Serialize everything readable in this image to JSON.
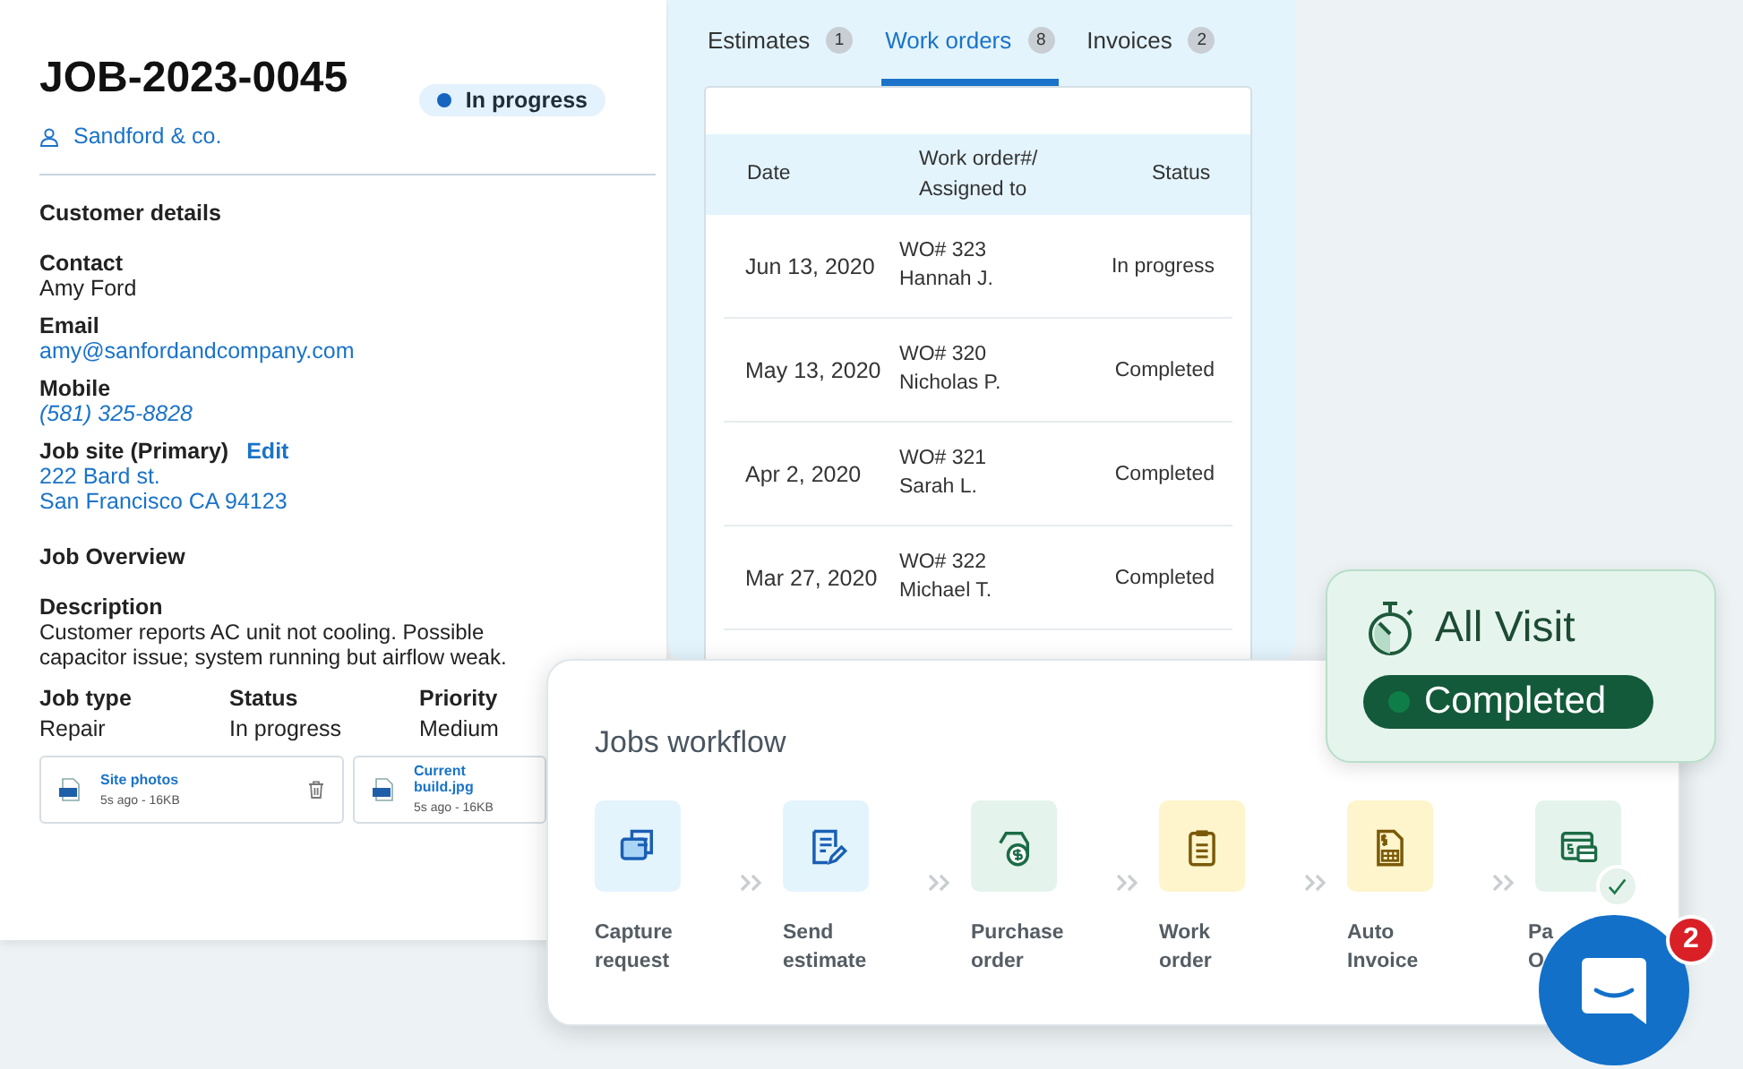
{
  "job": {
    "id": "JOB-2023-0045",
    "customer": "Sandford & co.",
    "status": "In progress",
    "customer_details": {
      "heading": "Customer details",
      "fields": [
        {
          "label": "Contact",
          "value": "Amy Ford",
          "kind": "text"
        },
        {
          "label": "Email",
          "value": "amy@sanfordandcompany.com",
          "kind": "link"
        },
        {
          "label": "Mobile",
          "value": "(581) 325-8828",
          "kind": "phone"
        }
      ],
      "job_site": {
        "label": "Job site (Primary)",
        "action": "Edit",
        "lines": [
          "222 Bard st.",
          "San Francisco CA 94123"
        ]
      }
    },
    "overview": {
      "heading": "Job Overview",
      "description_label": "Description",
      "description": "Customer reports AC unit not cooling. Possible capacitor issue; system running but airflow weak.",
      "facts": [
        {
          "label": "Job type",
          "value": "Repair"
        },
        {
          "label": "Status",
          "value": "In progress"
        },
        {
          "label": "Priority",
          "value": "Medium"
        }
      ],
      "attachments": [
        {
          "name": "Site photos",
          "meta": "5s ago - 16KB",
          "kind": "removable"
        },
        {
          "name": "Current build.jpg",
          "meta": "5s ago - 16KB",
          "kind": "file"
        }
      ]
    }
  },
  "orders": {
    "tabs": [
      {
        "label": "Estimates",
        "count": "1",
        "selected": false
      },
      {
        "label": "Work orders",
        "count": "8",
        "selected": true
      },
      {
        "label": "Invoices",
        "count": "2",
        "selected": false
      }
    ],
    "columns": [
      "Date",
      "Work order#/ Assigned to",
      "Status"
    ],
    "rows": [
      {
        "date": "Jun 13, 2020",
        "work_order": "WO# 323",
        "assignee": "Hannah J.",
        "status": "In progress"
      },
      {
        "date": "May 13, 2020",
        "work_order": "WO# 320",
        "assignee": "Nicholas P.",
        "status": "Completed"
      },
      {
        "date": "Apr 2, 2020",
        "work_order": "WO# 321",
        "assignee": "Sarah L.",
        "status": "Completed"
      },
      {
        "date": "Mar 27, 2020",
        "work_order": "WO# 322",
        "assignee": "Michael T.",
        "status": "Completed"
      }
    ]
  },
  "workflow": {
    "title": "Jobs workflow",
    "steps": [
      {
        "label": [
          "Capture",
          "request"
        ],
        "color": "#e3f4fd",
        "done": false
      },
      {
        "label": [
          "Send",
          "estimate"
        ],
        "color": "#e3f4fd",
        "done": false
      },
      {
        "label": [
          "Purchase",
          "order"
        ],
        "color": "#e4f3ec",
        "done": false
      },
      {
        "label": [
          "Work",
          "order"
        ],
        "color": "#fff5cc",
        "done": false
      },
      {
        "label": [
          "Auto",
          "Invoice"
        ],
        "color": "#fff5cc",
        "done": false
      },
      {
        "label": [
          "Pa",
          "O"
        ],
        "color": "#e4f3ec",
        "done": true
      }
    ]
  },
  "visit": {
    "title": "All Visit",
    "status": "Completed"
  },
  "chat": {
    "unread": "2"
  }
}
